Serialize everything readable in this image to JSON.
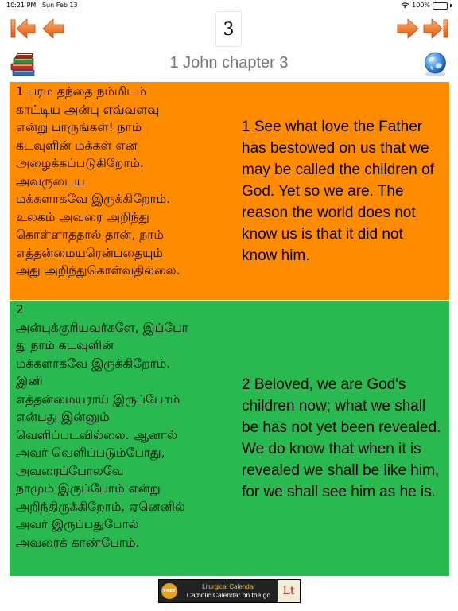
{
  "status_bar": {
    "time": "10:21 PM",
    "date": "Sun Feb 13",
    "battery": "100%",
    "battery_level": 1.0
  },
  "nav": {
    "chapter_number": "3",
    "title": "1 John chapter 3",
    "icons": {
      "first": "first-page-arrow-icon",
      "prev": "prev-arrow-icon",
      "next": "next-arrow-icon",
      "last": "last-page-arrow-icon",
      "books": "books-icon",
      "globe": "globe-icon"
    },
    "arrow_color": "#f26b1d"
  },
  "verses": [
    {
      "bg": "#ff8c00",
      "tamil_lines": [
        "1 பரம தந்தை நம்மிடம்",
        "காட்டிய அன்பு எவ்வளவு",
        "என்று பாருங்கள்! நாம்",
        "கடவுளின் மக்கள் என",
        "அழைக்கப்படுகிறோம்.",
        "அவருடைய",
        "மக்களாகவே இருக்கிறோம்.",
        "உலகம் அவரை அறிந்து",
        "கொள்ளாததால் தான், நாம்",
        "எத்தன்மையரென்பதையும்",
        "அது அறிந்துகொள்வதில்லை."
      ],
      "english": "1 See what love the Father has bestowed on us that we may be called the children of God. Yet so we are. The reason the world does not know us is that it did not know him."
    },
    {
      "bg": "#2ab851",
      "tamil_lines": [
        "2",
        "அன்புக்குரியவர்களே, இப்போ",
        "து நாம் கடவுளின்",
        "மக்களாகவே இருக்கிறோம்.",
        "இனி",
        "எத்தன்மையராய் இருப்போம்",
        "என்பது இன்னும்",
        "வெளிப்படவில்லை. ஆனால்",
        "அவர் வெளிப்படும்போது,",
        "அவரைப்போலவே",
        "நாமும் இருப்போம் என்று",
        "அறிந்திருக்கிறோம். ஏனெனில்",
        "அவர் இருப்பதுபோல்",
        "அவரைக் காண்போம்."
      ],
      "english": "2 Beloved, we are God's children now; what we shall be has not yet been revealed. We do know that when it is revealed we shall be like him, for we shall see him as he is."
    }
  ],
  "ad": {
    "badge": "FREE",
    "title": "Liturgical Calendar",
    "subtitle": "Catholic Calendar on the go",
    "logo": "Lt"
  }
}
